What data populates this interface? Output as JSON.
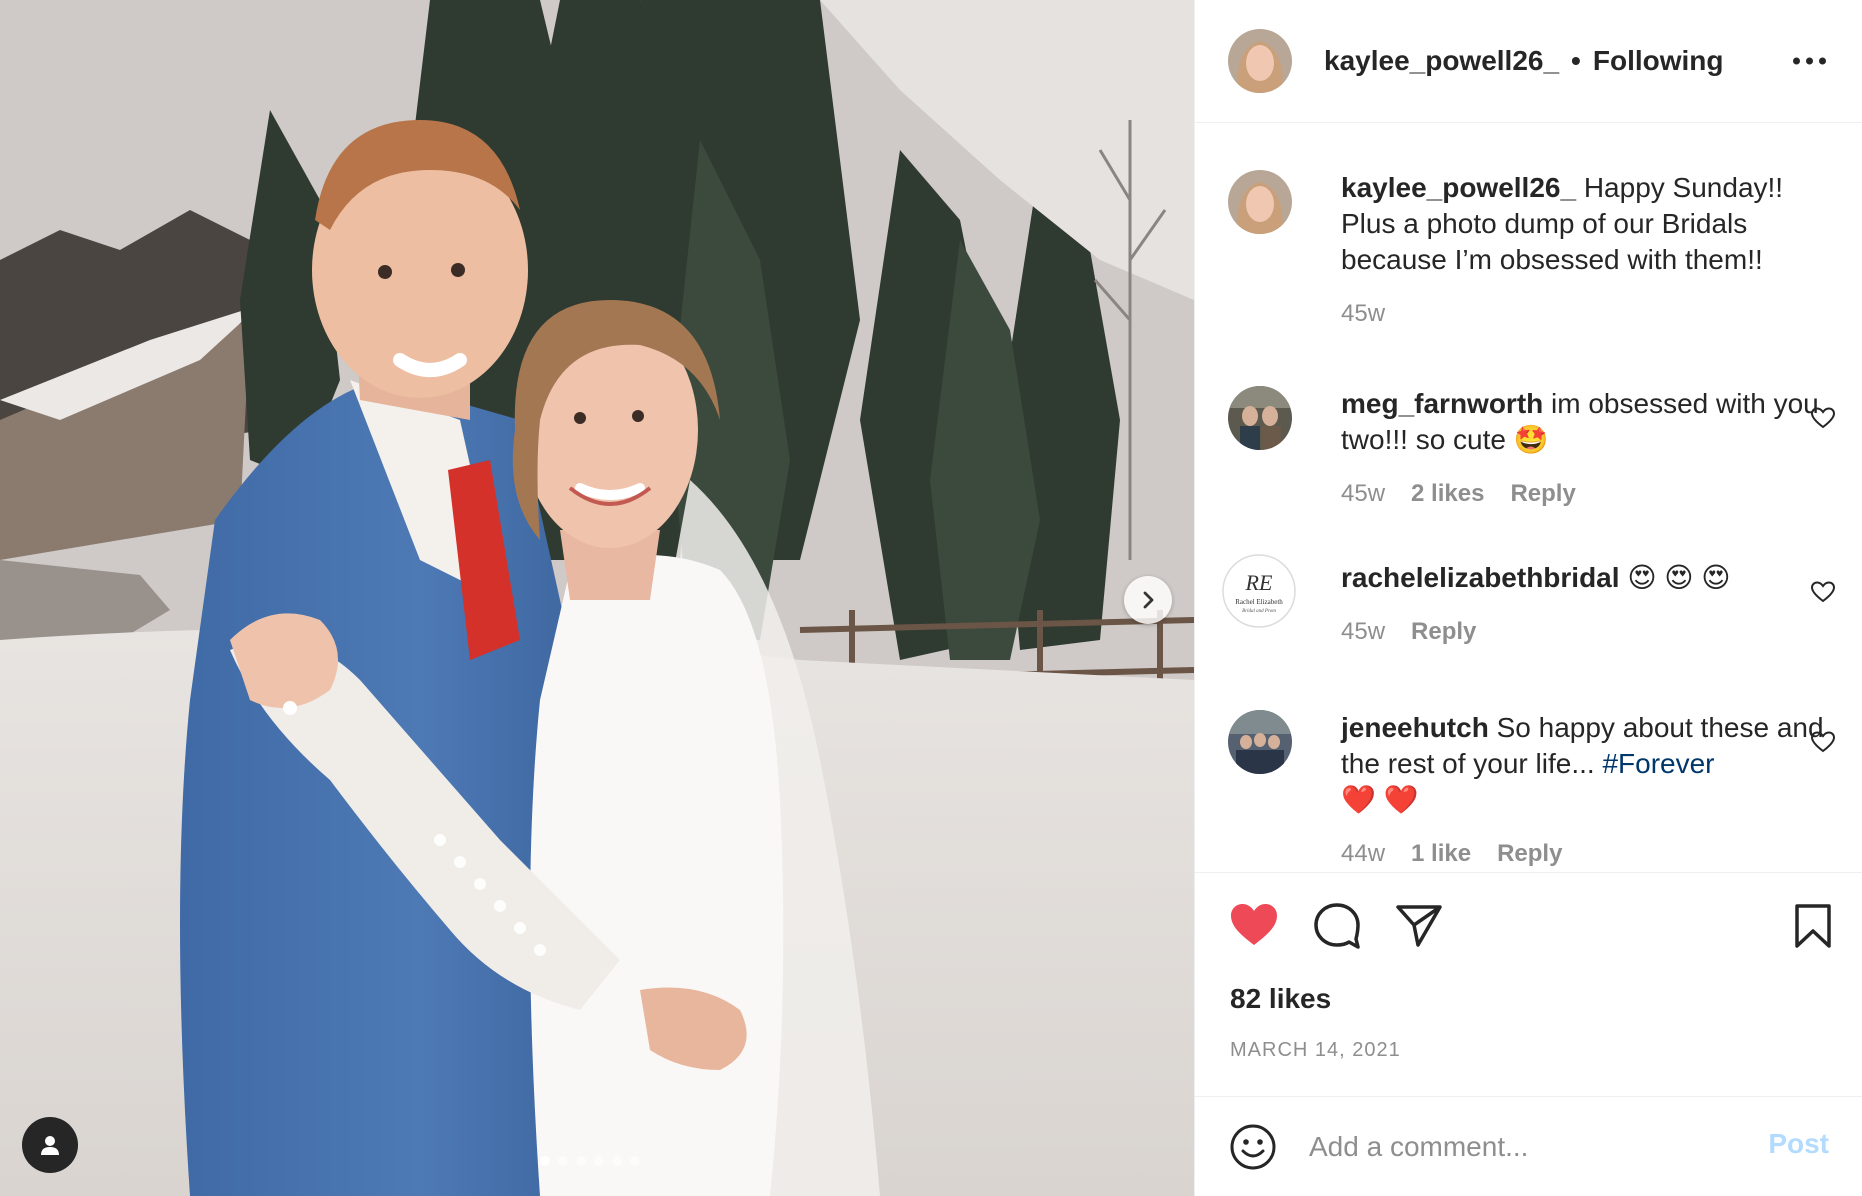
{
  "post": {
    "author": "kaylee_powell26_",
    "separator": "•",
    "follow_status": "Following",
    "image_count": 6,
    "active_image": 1
  },
  "caption": {
    "username": "kaylee_powell26_",
    "text": "Happy Sunday!! Plus a photo dump of our Bridals because I’m obsessed with them!!",
    "age": "45w"
  },
  "comments": [
    {
      "username": "meg_farnworth",
      "text": "im obsessed with you two!!! so cute",
      "emoji": "🤩",
      "age": "45w",
      "likes": "2 likes",
      "reply": "Reply"
    },
    {
      "username": "rachelelizabethbridal",
      "text": "",
      "emoji": "😍 😍 😍",
      "age": "45w",
      "likes": "",
      "reply": "Reply",
      "avatar_logo": {
        "monogram": "RE",
        "line1": "Rachel Elizabeth",
        "line2": "Bridal and Prom"
      }
    },
    {
      "username": "jeneehutch",
      "text": "So happy about these and the rest of your life...",
      "hashtag": "#Forever",
      "emoji": "❤️ ❤️",
      "age": "44w",
      "likes": "1 like",
      "reply": "Reply"
    }
  ],
  "actions": {
    "liked": true,
    "likes_text": "82 likes",
    "date": "MARCH 14, 2021"
  },
  "add_comment": {
    "placeholder": "Add a comment...",
    "post_label": "Post"
  },
  "icons": {
    "like": "heart-filled-icon",
    "comment": "comment-bubble-icon",
    "share": "paper-plane-icon",
    "save": "bookmark-icon",
    "emoji": "smiley-icon",
    "more": "ellipsis-icon",
    "next": "chevron-right-icon",
    "tag": "user-tag-icon"
  },
  "colors": {
    "like_red": "#ed4956",
    "text": "#262626",
    "secondary": "#8e8e8e",
    "hashtag": "#00376b",
    "post_disabled": "#b3dbff"
  }
}
